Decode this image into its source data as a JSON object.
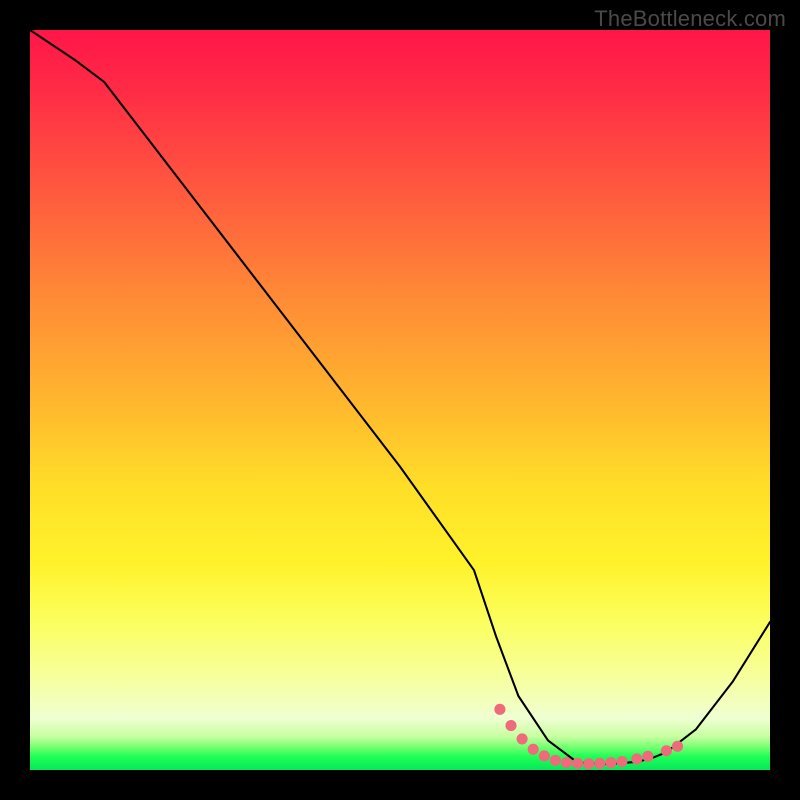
{
  "watermark": "TheBottleneck.com",
  "chart_data": {
    "type": "line",
    "title": "",
    "xlabel": "",
    "ylabel": "",
    "xlim": [
      0,
      100
    ],
    "ylim": [
      0,
      100
    ],
    "series": [
      {
        "name": "bottleneck-curve",
        "x": [
          0,
          6,
          10,
          20,
          30,
          40,
          50,
          60,
          63,
          66,
          70,
          74,
          78,
          82,
          84,
          86,
          90,
          95,
          100
        ],
        "y": [
          100,
          96,
          93,
          80,
          67,
          54,
          41,
          27,
          18,
          10,
          4,
          1,
          0.8,
          1.1,
          1.6,
          2.4,
          5.5,
          12,
          20
        ]
      }
    ],
    "markers": {
      "name": "flat-bottom-dots",
      "x": [
        63.5,
        65,
        66.5,
        68,
        69.5,
        71,
        72.5,
        74,
        75.5,
        77,
        78.5,
        80,
        82,
        83.5,
        86,
        87.5
      ],
      "y": [
        8.2,
        6.0,
        4.2,
        2.8,
        1.9,
        1.3,
        1.0,
        0.9,
        0.85,
        0.9,
        1.0,
        1.15,
        1.5,
        1.85,
        2.6,
        3.2
      ]
    },
    "gradient": {
      "top_color": "#ff1648",
      "bottom_color": "#06e85a",
      "note": "vertical red→yellow→green heat gradient"
    }
  }
}
